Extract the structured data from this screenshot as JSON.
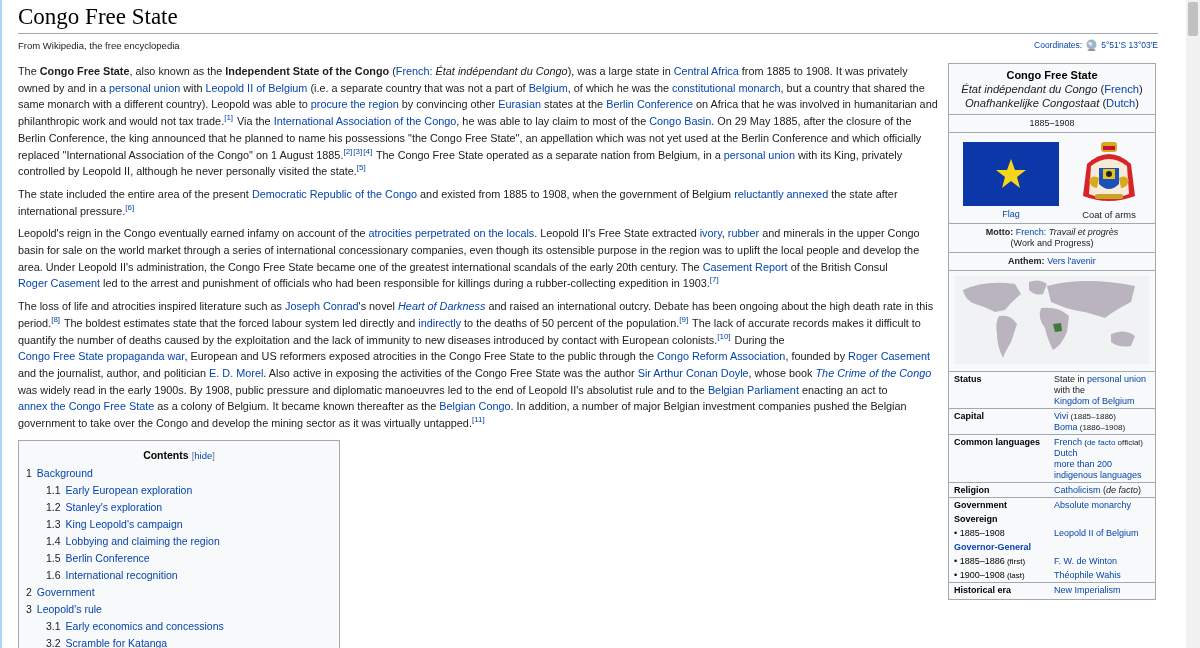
{
  "title": "Congo Free State",
  "tagline": "From Wikipedia, the free encyclopedia",
  "coordinates": {
    "label": "Coordinates:",
    "value": "5°51′S 13°03′E"
  },
  "paragraphs": [
    [
      "The ",
      {
        "kind": "bold",
        "text": "Congo Free State"
      },
      ", also known as the ",
      {
        "kind": "bold",
        "text": "Independent State of the Congo"
      },
      " (",
      {
        "kind": "link",
        "text": "French:"
      },
      {
        "kind": "italic",
        "text": " État indépendant du Congo"
      },
      "), was a large state in ",
      {
        "kind": "link",
        "text": "Central Africa"
      },
      " from 1885 to 1908. It was privately owned by and in a ",
      {
        "kind": "link",
        "text": "personal union"
      },
      " with ",
      {
        "kind": "link",
        "text": "Leopold II of Belgium"
      },
      " (i.e. a separate country that was not a part of ",
      {
        "kind": "link",
        "text": "Belgium"
      },
      ", of which he was the ",
      {
        "kind": "link",
        "text": "constitutional monarch"
      },
      ", but a country that shared the same monarch with a different country). Leopold was able to ",
      {
        "kind": "link",
        "text": "procure the region"
      },
      " by convincing other ",
      {
        "kind": "link",
        "text": "Eurasian"
      },
      " states at the ",
      {
        "kind": "link",
        "text": "Berlin Conference"
      },
      " on Africa that he was involved in humanitarian and philanthropic work and would not tax trade.",
      {
        "kind": "ref",
        "text": "[1]"
      },
      " Via the ",
      {
        "kind": "link",
        "text": "International Association of the Congo"
      },
      ", he was able to lay claim to most of the ",
      {
        "kind": "link",
        "text": "Congo Basin"
      },
      ". On 29 May 1885, after the closure of the Berlin Conference, the king announced that he planned to name his possessions \"the Congo Free State\", an appellation which was not yet used at the Berlin Conference and which officially replaced \"International Association of the Congo\" on 1 August 1885.",
      {
        "kind": "ref",
        "text": "[2]"
      },
      {
        "kind": "ref",
        "text": "[3]"
      },
      {
        "kind": "ref",
        "text": "[4]"
      },
      " The Congo Free State operated as a separate nation from Belgium, in a ",
      {
        "kind": "link",
        "text": "personal union"
      },
      " with its King, privately controlled by Leopold II, although he never personally visited the state.",
      {
        "kind": "ref",
        "text": "[5]"
      }
    ],
    [
      "The state included the entire area of the present ",
      {
        "kind": "link",
        "text": "Democratic Republic of the Congo"
      },
      " and existed from 1885 to 1908, when the government of Belgium ",
      {
        "kind": "link",
        "text": "reluctantly annexed"
      },
      " the state after international pressure.",
      {
        "kind": "ref",
        "text": "[6]"
      }
    ],
    [
      "Leopold's reign in the Congo eventually earned infamy on account of the ",
      {
        "kind": "link",
        "text": "atrocities perpetrated on the locals"
      },
      ". Leopold II's Free State extracted ",
      {
        "kind": "link",
        "text": "ivory"
      },
      ", ",
      {
        "kind": "link",
        "text": "rubber"
      },
      " and minerals in the upper Congo basin for sale on the world market through a series of international concessionary companies, even though its ostensible purpose in the region was to uplift the local people and develop the area. Under Leopold II's administration, the Congo Free State became one of the greatest international scandals of the early 20th century. The ",
      {
        "kind": "link",
        "text": "Casement Report"
      },
      " of the British Consul ",
      {
        "kind": "link",
        "text": "Roger Casement"
      },
      " led to the arrest and punishment of officials who had been responsible for killings during a rubber-collecting expedition in 1903.",
      {
        "kind": "ref",
        "text": "[7]"
      }
    ],
    [
      "The loss of life and atrocities inspired literature such as ",
      {
        "kind": "link",
        "text": "Joseph Conrad"
      },
      "'s novel ",
      {
        "kind": "italic-link",
        "text": "Heart of Darkness"
      },
      " and raised an international outcry. Debate has been ongoing about the high death rate in this period.",
      {
        "kind": "ref",
        "text": "[8]"
      },
      " The boldest estimates state that the forced labour system led directly and ",
      {
        "kind": "link",
        "text": "indirectly"
      },
      " to the deaths of 50 percent of the population.",
      {
        "kind": "ref",
        "text": "[9]"
      },
      " The lack of accurate records makes it difficult to quantify the number of deaths caused by the exploitation and the lack of immunity to new diseases introduced by contact with European colonists.",
      {
        "kind": "ref",
        "text": "[10]"
      },
      " During the ",
      {
        "kind": "link",
        "text": "Congo Free State propaganda war"
      },
      ", European and US reformers exposed atrocities in the Congo Free State to the public through the ",
      {
        "kind": "link",
        "text": "Congo Reform Association"
      },
      ", founded by ",
      {
        "kind": "link",
        "text": "Roger Casement"
      },
      " and the journalist, author, and politician ",
      {
        "kind": "link",
        "text": "E. D. Morel"
      },
      ". Also active in exposing the activities of the Congo Free State was the author ",
      {
        "kind": "link",
        "text": "Sir Arthur Conan Doyle"
      },
      ", whose book ",
      {
        "kind": "italic-link",
        "text": "The Crime of the Congo"
      },
      " was widely read in the early 1900s. By 1908, public pressure and diplomatic manoeuvres led to the end of Leopold II's absolutist rule and to the ",
      {
        "kind": "link",
        "text": "Belgian Parliament"
      },
      " enacting an act to ",
      {
        "kind": "link",
        "text": "annex the Congo Free State"
      },
      " as a colony of Belgium. It became known thereafter as the ",
      {
        "kind": "link",
        "text": "Belgian Congo"
      },
      ". In addition, a number of major Belgian investment companies pushed the Belgian government to take over the Congo and develop the mining sector as it was virtually untapped.",
      {
        "kind": "ref",
        "text": "[11]"
      }
    ]
  ],
  "toc": {
    "title": "Contents",
    "toggle_open": "[",
    "toggle": "hide",
    "toggle_close": "]",
    "items": [
      {
        "number": "1",
        "label": "Background",
        "children": [
          {
            "number": "1.1",
            "label": "Early European exploration"
          },
          {
            "number": "1.2",
            "label": "Stanley's exploration"
          },
          {
            "number": "1.3",
            "label": "King Leopold's campaign"
          },
          {
            "number": "1.4",
            "label": "Lobbying and claiming the region"
          },
          {
            "number": "1.5",
            "label": "Berlin Conference"
          },
          {
            "number": "1.6",
            "label": "International recognition"
          }
        ]
      },
      {
        "number": "2",
        "label": "Government"
      },
      {
        "number": "3",
        "label": "Leopold's rule",
        "children": [
          {
            "number": "3.1",
            "label": "Early economics and concessions"
          },
          {
            "number": "3.2",
            "label": "Scramble for Katanga"
          }
        ]
      }
    ]
  },
  "infobox": {
    "title": "Congo Free State",
    "native_names": [
      {
        "name": "État indépendant du Congo",
        "open": "(",
        "lang": "French",
        "close": ")"
      },
      {
        "name": "Onafhankelijke Congostaat",
        "open": "(",
        "lang": "Dutch",
        "close": ")"
      }
    ],
    "years": "1885–1908",
    "flag_caption": "Flag",
    "arms_caption": "Coat of arms",
    "motto": {
      "label": "Motto:",
      "lang": "French:",
      "text": "Travail et progrès",
      "translation": "(Work and Progress)"
    },
    "anthem": {
      "label": "Anthem:",
      "value": "Vers l'avenir"
    },
    "rows": [
      {
        "kind": "row",
        "label": [
          "Status"
        ],
        "values": [
          [
            "State in ",
            {
              "kind": "link",
              "text": "personal union"
            },
            " with the ",
            {
              "kind": "link",
              "text": "Kingdom of Belgium"
            }
          ]
        ]
      },
      {
        "kind": "row",
        "label": [
          "Capital"
        ],
        "values": [
          [
            {
              "kind": "link",
              "text": "Vivi"
            },
            {
              "kind": "small",
              "text": " (1885–1886)"
            }
          ],
          [
            {
              "kind": "link",
              "text": "Boma"
            },
            {
              "kind": "small",
              "text": " (1886–1908)"
            }
          ]
        ]
      },
      {
        "kind": "row",
        "label": [
          "Common languages"
        ],
        "values": [
          [
            {
              "kind": "link",
              "text": "French"
            },
            {
              "kind": "small",
              "text": " ("
            },
            {
              "kind": "small-link",
              "text": "de facto"
            },
            {
              "kind": "small",
              "text": " official)"
            }
          ],
          [
            {
              "kind": "link",
              "text": "Dutch"
            }
          ],
          [
            {
              "kind": "link",
              "text": "more than 200 indigenous languages"
            }
          ]
        ]
      },
      {
        "kind": "row",
        "label": [
          "Religion"
        ],
        "values": [
          [
            {
              "kind": "link",
              "text": "Catholicism"
            },
            " (",
            {
              "kind": "italic",
              "text": "de facto"
            },
            ")"
          ]
        ]
      },
      {
        "kind": "row",
        "label": [
          "Government"
        ],
        "values": [
          [
            {
              "kind": "link",
              "text": "Absolute monarchy"
            }
          ]
        ]
      },
      {
        "kind": "subheader",
        "label": "Sovereign",
        "link": false
      },
      {
        "kind": "subrow",
        "label": [
          "• 1885–1908"
        ],
        "values": [
          [
            {
              "kind": "link",
              "text": "Leopold II of Belgium"
            }
          ]
        ]
      },
      {
        "kind": "subheader",
        "label": "Governor-General",
        "link": true
      },
      {
        "kind": "subrow",
        "label": [
          "• 1885–1886",
          {
            "kind": "small",
            "text": " (first)"
          }
        ],
        "values": [
          [
            {
              "kind": "link",
              "text": "F. W. de Winton"
            }
          ]
        ]
      },
      {
        "kind": "subrow",
        "label": [
          "• 1900–1908",
          {
            "kind": "small",
            "text": " (last)"
          }
        ],
        "values": [
          [
            {
              "kind": "link",
              "text": "Théophile Wahis"
            }
          ]
        ]
      },
      {
        "kind": "row",
        "label": [
          "Historical era"
        ],
        "values": [
          [
            {
              "kind": "link",
              "text": "New Imperialism"
            }
          ]
        ]
      }
    ]
  }
}
